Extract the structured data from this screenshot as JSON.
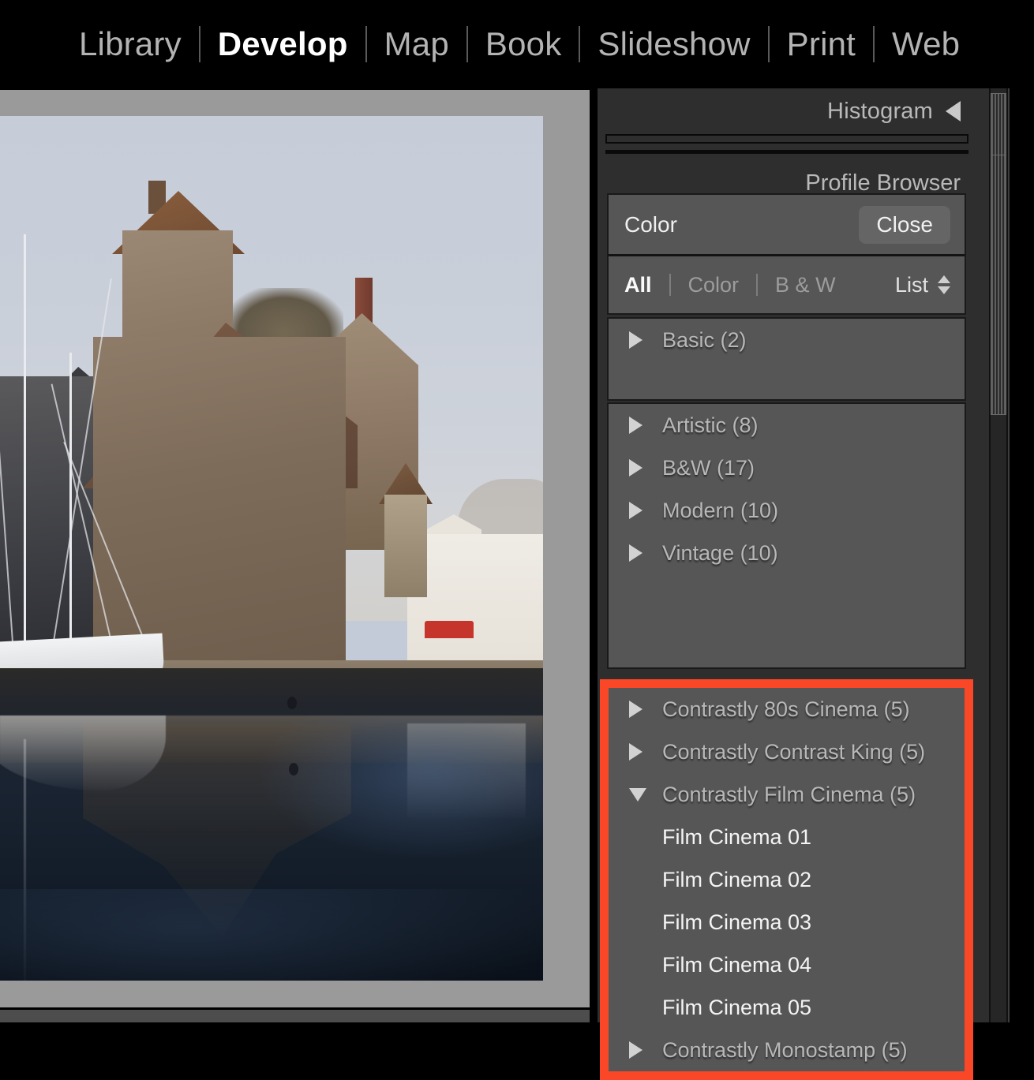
{
  "topbar": {
    "modules": [
      {
        "label": "Library",
        "active": false
      },
      {
        "label": "Develop",
        "active": true
      },
      {
        "label": "Map",
        "active": false
      },
      {
        "label": "Book",
        "active": false
      },
      {
        "label": "Slideshow",
        "active": false
      },
      {
        "label": "Print",
        "active": false
      },
      {
        "label": "Web",
        "active": false
      }
    ]
  },
  "right_panel": {
    "histogram": {
      "title": "Histogram",
      "collapse_icon": "triangle-left-icon"
    },
    "profile_browser": {
      "title": "Profile Browser",
      "current_profile_label": "Color",
      "close_label": "Close",
      "filters": [
        {
          "label": "All",
          "selected": true
        },
        {
          "label": "Color",
          "selected": false
        },
        {
          "label": "B & W",
          "selected": false
        }
      ],
      "view_mode": "List",
      "view_mode_icon": "stepper-updown-icon",
      "groups_basic": [
        {
          "label": "Basic (2)",
          "expanded": false,
          "icon": "triangle-right-icon"
        }
      ],
      "groups_stock": [
        {
          "label": "Artistic (8)",
          "expanded": false,
          "icon": "triangle-right-icon"
        },
        {
          "label": "B&W (17)",
          "expanded": false,
          "icon": "triangle-right-icon"
        },
        {
          "label": "Modern (10)",
          "expanded": false,
          "icon": "triangle-right-icon"
        },
        {
          "label": "Vintage (10)",
          "expanded": false,
          "icon": "triangle-right-icon"
        }
      ],
      "groups_custom": [
        {
          "label": "Contrastly 80s Cinema (5)",
          "expanded": false,
          "icon": "triangle-right-icon",
          "type": "group"
        },
        {
          "label": "Contrastly Contrast King (5)",
          "expanded": false,
          "icon": "triangle-right-icon",
          "type": "group"
        },
        {
          "label": "Contrastly Film Cinema (5)",
          "expanded": true,
          "icon": "triangle-down-icon",
          "type": "group"
        },
        {
          "label": "Film Cinema 01",
          "type": "profile"
        },
        {
          "label": "Film Cinema 02",
          "type": "profile"
        },
        {
          "label": "Film Cinema 03",
          "type": "profile"
        },
        {
          "label": "Film Cinema 04",
          "type": "profile"
        },
        {
          "label": "Film Cinema 05",
          "type": "profile"
        },
        {
          "label": "Contrastly Monostamp (5)",
          "expanded": false,
          "icon": "triangle-right-icon",
          "type": "group"
        }
      ],
      "highlight_color": "#fa4727"
    },
    "panel_toggle_icon": "triangle-right-icon"
  },
  "colors": {
    "app_background": "#000000",
    "panel_background": "#2e2e2e",
    "group_background": "#565656",
    "stage_background": "#9a9a9a",
    "accent_highlight": "#fa4727",
    "text_primary": "#f0f0f0",
    "text_secondary": "#b8b8b8"
  }
}
